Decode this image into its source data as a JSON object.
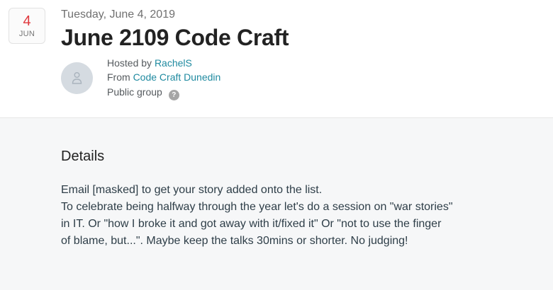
{
  "date_badge": {
    "day": "4",
    "month": "JUN"
  },
  "event": {
    "date_text": "Tuesday, June 4, 2019",
    "title": "June 2109 Code Craft"
  },
  "meta": {
    "hosted_prefix": "Hosted by ",
    "host_name": "RachelS",
    "from_prefix": "From ",
    "group_name": "Code Craft Dunedin",
    "visibility": "Public group",
    "help_symbol": "?"
  },
  "details": {
    "heading": "Details",
    "lines": [
      "Email [masked] to get your story added onto the list.",
      "To celebrate being halfway through the year let's do a session on \"war stories\"",
      "in IT. Or \"how I broke it and got away with it/fixed it\" Or \"not to use the finger",
      "of blame, but...\". Maybe keep the talks 30mins or shorter. No judging!"
    ]
  },
  "colors": {
    "accent_red": "#e0393e",
    "link_teal": "#1f8aa0",
    "page_gray": "#f6f7f8"
  },
  "icons": {
    "avatar": "user-placeholder-icon",
    "help": "help-icon"
  }
}
